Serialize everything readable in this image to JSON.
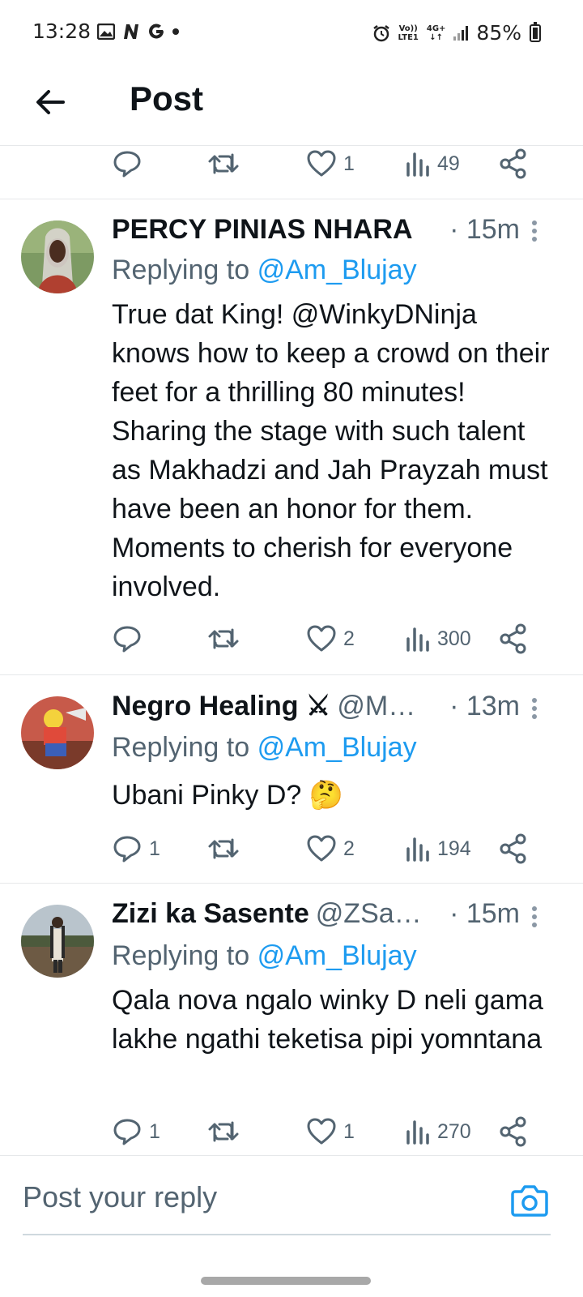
{
  "status_bar": {
    "time": "13:28",
    "left_icons": [
      "gallery-icon",
      "n-icon",
      "google-icon",
      "dot-icon"
    ],
    "volte_top": "Vo))",
    "volte_bottom": "LTE1",
    "network_top": "4G+",
    "network_bottom": "↓↑",
    "battery": "85%"
  },
  "header": {
    "title": "Post",
    "back_icon": "arrow-left-icon"
  },
  "top_actions": {
    "reply_count": "",
    "repost_count": "",
    "like_count": "1",
    "view_count": "49"
  },
  "tweets": [
    {
      "name": "PERCY PINIAS NHARA",
      "handle": "",
      "time": "· 15m",
      "replying_prefix": "Replying to",
      "replying_to": "@Am_Blujay",
      "body": "True dat King! @WinkyDNinja knows how to keep a crowd on their feet for a thrilling 80 minutes! Sharing the stage with such talent as Makhadzi and Jah Prayzah must have been an honor for them. Moments to cherish for everyone involved.",
      "reply_count": "",
      "repost_count": "",
      "like_count": "2",
      "view_count": "300"
    },
    {
      "name": "Negro Healing ⚔",
      "handle": "@M…",
      "time": "· 13m",
      "replying_prefix": "Replying to",
      "replying_to": "@Am_Blujay",
      "body": "Ubani Pinky D? 🤔",
      "reply_count": "1",
      "repost_count": "",
      "like_count": "2",
      "view_count": "194"
    },
    {
      "name": "Zizi ka Sasente",
      "handle": "@ZSa…",
      "time": "· 15m",
      "replying_prefix": "Replying to",
      "replying_to": "@Am_Blujay",
      "body": "Qala nova ngalo winky D neli gama lakhe ngathi teketisa pipi yomntana",
      "reply_count": "1",
      "repost_count": "",
      "like_count": "1",
      "view_count": "270"
    }
  ],
  "compose": {
    "placeholder": "Post your reply",
    "camera_icon": "camera-icon"
  },
  "colors": {
    "accent": "#1d9bf0",
    "secondary_text": "#536471",
    "primary_text": "#0f1419",
    "divider": "#e6e8ea"
  }
}
